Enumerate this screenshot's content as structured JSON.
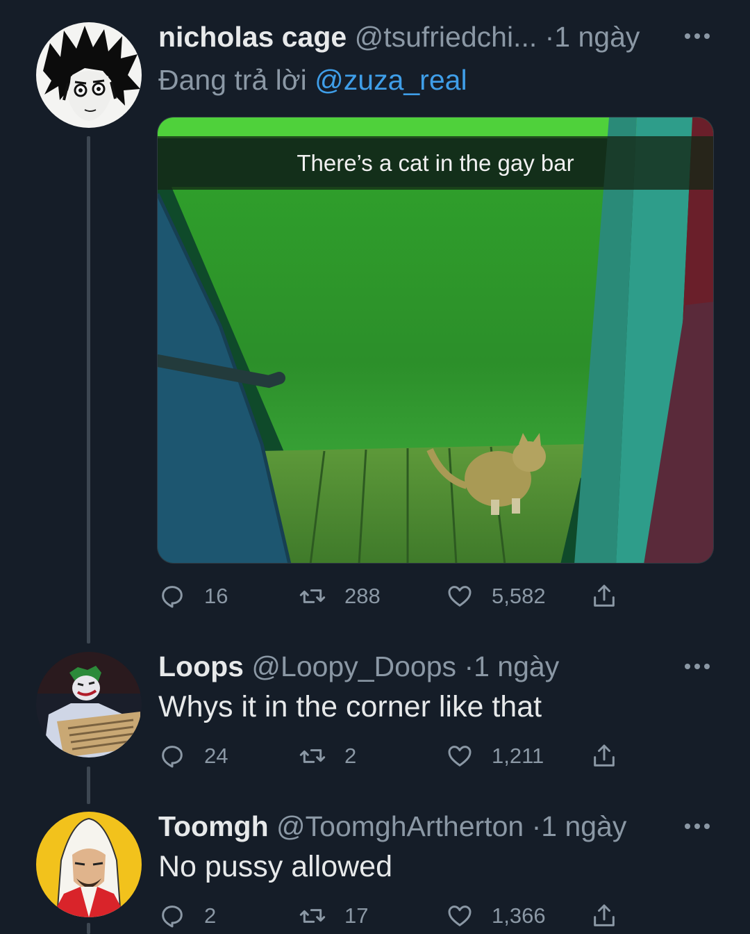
{
  "tweets": [
    {
      "name": "nicholas cage",
      "handle": "@tsufriedchi...",
      "dot": "·",
      "time": "1 ngày",
      "reply_prefix": "Đang trả lời",
      "reply_to": "@zuza_real",
      "media_caption": "There’s a cat in the gay bar",
      "replies": "16",
      "retweets": "288",
      "likes": "5,582"
    },
    {
      "name": "Loops",
      "handle": "@Loopy_Doops",
      "dot": "·",
      "time": "1 ngày",
      "text": "Whys it in the corner like that",
      "replies": "24",
      "retweets": "2",
      "likes": "1,211"
    },
    {
      "name": "Toomgh",
      "handle": "@ToomghArtherton",
      "dot": "·",
      "time": "1 ngày",
      "text": "No pussy allowed",
      "replies": "2",
      "retweets": "17",
      "likes": "1,366"
    }
  ],
  "icons": {
    "reply": "reply-icon",
    "retweet": "retweet-icon",
    "like": "heart-icon",
    "share": "share-icon",
    "more": "more-icon"
  },
  "colors": {
    "background": "#151d28",
    "mention": "#3f9ee8",
    "muted": "#8b98a5"
  }
}
